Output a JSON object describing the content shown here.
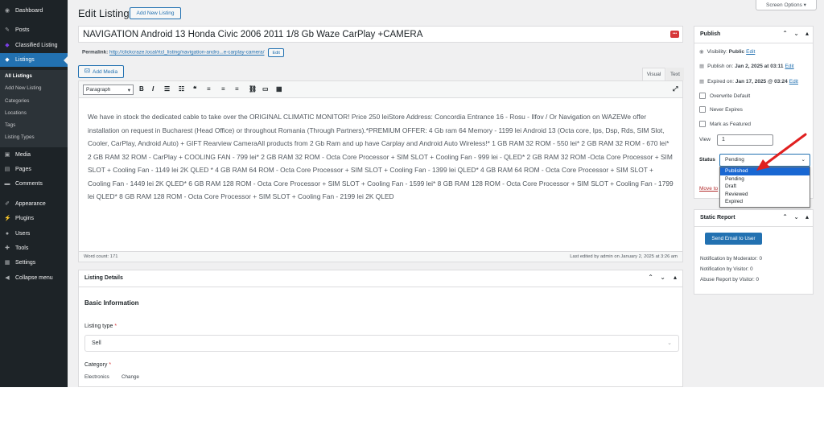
{
  "admin_menu": {
    "items": [
      {
        "label": "Dashboard",
        "icon": "dashboard-icon"
      },
      {
        "label": "Posts",
        "icon": "pin-icon"
      },
      {
        "label": "Classified Listing",
        "icon": "classified-icon"
      },
      {
        "label": "Listings",
        "icon": "listings-icon"
      },
      {
        "label": "Media",
        "icon": "media-icon"
      },
      {
        "label": "Pages",
        "icon": "pages-icon"
      },
      {
        "label": "Comments",
        "icon": "comments-icon"
      },
      {
        "label": "Appearance",
        "icon": "appearance-icon"
      },
      {
        "label": "Plugins",
        "icon": "plugins-icon"
      },
      {
        "label": "Users",
        "icon": "users-icon"
      },
      {
        "label": "Tools",
        "icon": "tools-icon"
      },
      {
        "label": "Settings",
        "icon": "settings-icon"
      },
      {
        "label": "Collapse menu",
        "icon": "collapse-icon"
      }
    ],
    "submenu": [
      "All Listings",
      "Add New Listing",
      "Categories",
      "Locations",
      "Tags",
      "Listing Types"
    ]
  },
  "header": {
    "title": "Edit Listing",
    "add_new": "Add New Listing",
    "screen_options": "Screen Options"
  },
  "post": {
    "title": "NAVIGATION Android 13 Honda Civic 2006 2011 1/8 Gb Waze CarPlay +CAMERA",
    "permalink_label": "Permalink:",
    "permalink_url": "http://clickcraze.local/rtcl_listing/navigation-andro...e-carplay-camera/",
    "permalink_edit": "Edit"
  },
  "editor": {
    "add_media": "Add Media",
    "tab_visual": "Visual",
    "tab_text": "Text",
    "format": "Paragraph",
    "content": "We have in stock the dedicated cable to take over the ORIGINAL CLIMATIC MONITOR! Price 250 leiStore Address: Concordia Entrance 16 - Rosu - Ilfov / Or Navigation on WAZEWe offer installation on request in Bucharest (Head Office) or throughout Romania (Through Partners).*PREMIUM OFFER: 4 Gb ram 64 Memory - 1199 lei Android 13 (Octa core, Ips, Dsp, Rds, SIM Slot, Cooler, CarPlay, Android Auto) + GIFT Rearview CameraAll products from 2 Gb Ram and up have Carplay and Android Auto Wireless!* 1 GB RAM 32 ROM - 550 lei* 2 GB RAM 32 ROM - 670 lei* 2 GB RAM 32 ROM - CarPlay + COOLING FAN - 799 lei* 2 GB RAM 32 ROM - Octa Core Processor + SIM SLOT + Cooling Fan - 999 lei - QLED* 2 GB RAM 32 ROM -Octa Core Processor + SIM SLOT + Cooling Fan - 1149 lei 2K QLED * 4 GB RAM 64 ROM - Octa Core Processor + SIM SLOT + Cooling Fan - 1399 lei QLED* 4 GB RAM 64 ROM - Octa Core Processor + SIM SLOT + Cooling Fan - 1449 lei 2K QLED* 6 GB RAM 128 ROM - Octa Core Processor + SIM SLOT + Cooling Fan - 1599 lei* 8 GB RAM 128 ROM - Octa Core Processor + SIM SLOT + Cooling Fan - 1799 lei QLED* 8 GB RAM 128 ROM - Octa Core Processor + SIM SLOT + Cooling Fan - 2199 lei 2K QLED",
    "word_count": "Word count: 171",
    "last_edited": "Last edited by admin on January 2, 2025 at 3:26 am"
  },
  "listing_details": {
    "title": "Listing Details",
    "section": "Basic Information",
    "listing_type_label": "Listing type",
    "required": "*",
    "listing_type_value": "Sell",
    "category_label": "Category",
    "category_value": "Electronics",
    "category_change": "Change"
  },
  "publish": {
    "title": "Publish",
    "visibility": "Visibility:",
    "visibility_value": "Public",
    "publish_on": "Publish on:",
    "publish_date": "Jan 2, 2025 at 03:11",
    "expired_on": "Expired on:",
    "expired_date": "Jan 17, 2025 @ 03:24",
    "edit": "Edit",
    "overwrite_default": "Overwrite Default",
    "never_expires": "Never Expires",
    "mark_featured": "Mark as Featured",
    "view_label": "View",
    "view_value": "1",
    "status_label": "Status",
    "status_value": "Pending",
    "status_options": [
      "Published",
      "Pending",
      "Draft",
      "Reviewed",
      "Expired"
    ],
    "move_to": "Move to"
  },
  "static_report": {
    "title": "Static Report",
    "send_email": "Send Email to User",
    "moderator": "Notification by Moderator: 0",
    "visitor": "Notification by Visitor: 0",
    "abuse": "Abuse Report by Visitor: 0"
  },
  "colors": {
    "accent": "#2271b1",
    "menu_bg": "#1d2327",
    "arrow": "#e02020"
  }
}
